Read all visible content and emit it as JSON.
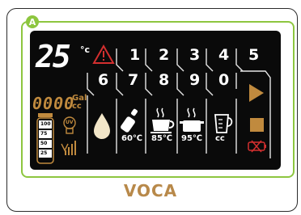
{
  "badge": "A",
  "temperature": {
    "value": "25",
    "unit": "°c"
  },
  "keys_row1": [
    "1",
    "2",
    "3",
    "4",
    "5"
  ],
  "keys_row2": [
    "6",
    "7",
    "8",
    "9",
    "0"
  ],
  "volume": {
    "digits": "0000",
    "unit_top": "Gal",
    "unit_bottom": "cc"
  },
  "tank_levels": [
    "100",
    "75",
    "50",
    "25"
  ],
  "uv_label": "UV",
  "modes": [
    {
      "label": "",
      "icon": "water-drop-icon"
    },
    {
      "label": "60℃",
      "icon": "baby-bottle-icon"
    },
    {
      "label": "85℃",
      "icon": "coffee-cup-icon"
    },
    {
      "label": "95℃",
      "icon": "cooking-pot-icon"
    },
    {
      "label": "cc",
      "icon": "measuring-cup-icon"
    }
  ],
  "brand": "VOCA",
  "colors": {
    "accent_green": "#8dc63f",
    "gold": "#c08a3e",
    "warning_red": "#d32f2f"
  }
}
